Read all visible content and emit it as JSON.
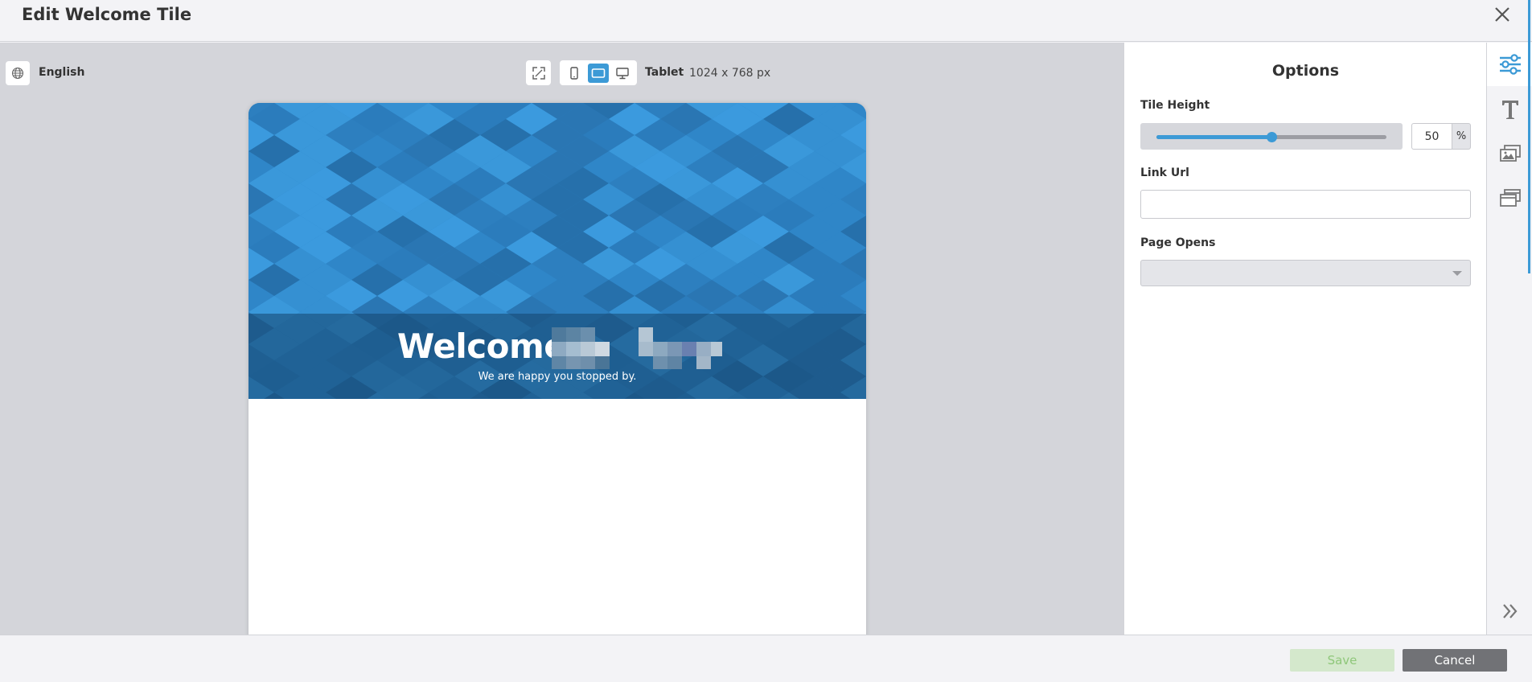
{
  "dialog": {
    "title": "Edit Welcome Tile",
    "close_icon": "close-icon"
  },
  "preview": {
    "language": "English",
    "device": "Tablet",
    "device_size": "1024 x 768 px",
    "devices": [
      "phone-icon",
      "tablet-icon",
      "desktop-icon"
    ],
    "active_device": "tablet"
  },
  "tile": {
    "welcome": "Welcome,",
    "subtitle": "We are happy you stopped by."
  },
  "options": {
    "title": "Options",
    "tile_height_label": "Tile Height",
    "tile_height_value": "50",
    "tile_height_unit": "%",
    "link_url_label": "Link Url",
    "link_url_value": "",
    "page_opens_label": "Page Opens",
    "page_opens_value": ""
  },
  "rail": {
    "items": [
      "options-icon",
      "text-icon",
      "image-icon",
      "gallery-icon"
    ],
    "collapse_icon": "double-chevron-right-icon"
  },
  "footer": {
    "save_label": "Save",
    "cancel_label": "Cancel"
  },
  "colors": {
    "accent": "#3c9ad6",
    "banner_blue": "#2f86c8",
    "save_bg": "#d4e8cc",
    "cancel_bg": "#717276"
  }
}
